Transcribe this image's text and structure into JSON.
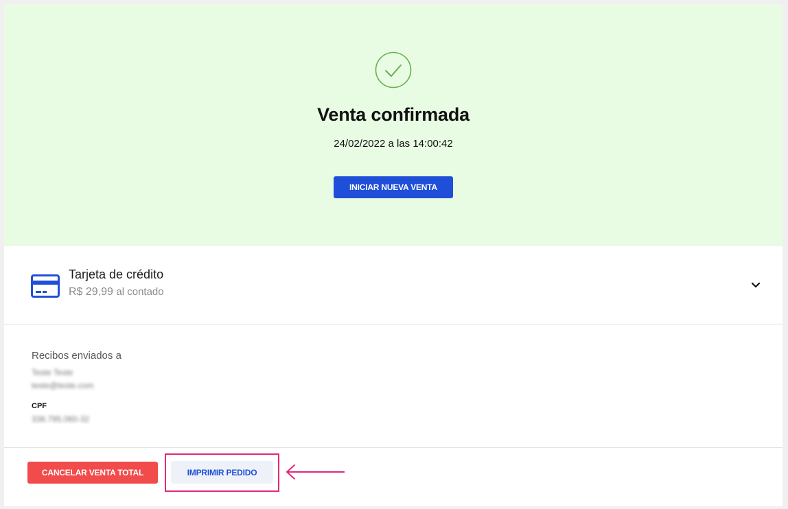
{
  "hero": {
    "title": "Venta confirmada",
    "date": "24/02/2022 a las 14:00:42",
    "new_sale_button": "INICIAR NUEVA VENTA",
    "icon": "check-circle-icon",
    "background": "#e8fbe3",
    "check_color": "#6ab04c"
  },
  "payment": {
    "method": "Tarjeta de crédito",
    "amount": "R$ 29,99",
    "terms": "al contado",
    "icon": "credit-card-icon",
    "expand_icon": "chevron-down-icon"
  },
  "receipts": {
    "title": "Recibos enviados a",
    "name": "Teste Teste",
    "email": "teste@teste.com",
    "cpf_label": "CPF",
    "cpf_value": "336.795.060-32"
  },
  "actions": {
    "cancel_label": "CANCELAR VENTA TOTAL",
    "print_label": "IMPRIMIR PEDIDO"
  },
  "colors": {
    "primary": "#1f4fd8",
    "danger": "#f24b4b",
    "highlight": "#e0287a"
  }
}
